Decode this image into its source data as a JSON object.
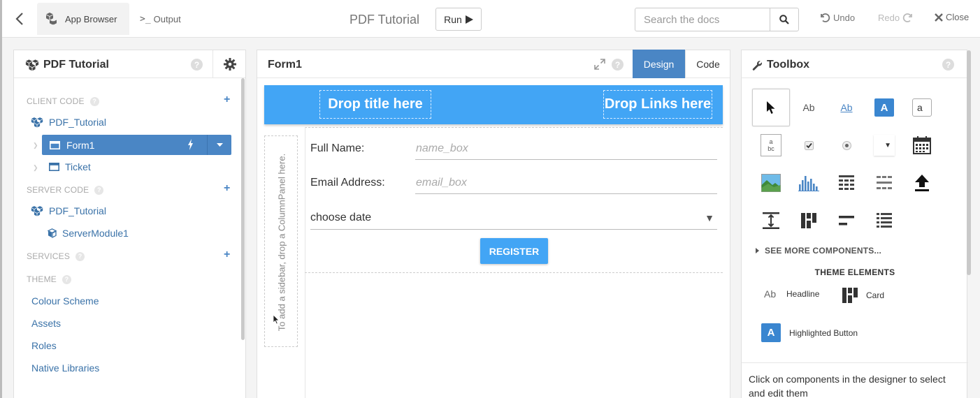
{
  "topbar": {
    "app_tab_label": "App Browser",
    "output_tab_label": "Output",
    "title": "PDF Tutorial",
    "run_label": "Run",
    "search_placeholder": "Search the docs",
    "undo_label": "Undo",
    "redo_label": "Redo",
    "close_label": "Close"
  },
  "left_panel": {
    "title": "PDF Tutorial",
    "client_code_label": "CLIENT CODE",
    "client_app": "PDF_Tutorial",
    "forms": [
      {
        "label": "Form1",
        "selected": true
      },
      {
        "label": "Ticket",
        "selected": false
      }
    ],
    "server_code_label": "SERVER CODE",
    "server_app": "PDF_Tutorial",
    "server_module": "ServerModule1",
    "services_label": "SERVICES",
    "theme_label": "THEME",
    "theme_items": [
      "Colour Scheme",
      "Assets",
      "Roles",
      "Native Libraries"
    ]
  },
  "designer": {
    "title": "Form1",
    "design_tab": "Design",
    "code_tab": "Code",
    "drop_title": "Drop title here",
    "drop_links": "Drop Links here",
    "sidebar_hint": "To add a sidebar, drop a ColumnPanel here.",
    "full_name_label": "Full Name:",
    "name_placeholder": "name_box",
    "email_label": "Email Address:",
    "email_placeholder": "email_box",
    "date_placeholder": "choose date",
    "register_label": "REGISTER",
    "accent_color": "#42a5f5"
  },
  "toolbox": {
    "title": "Toolbox",
    "label_sample": "Ab",
    "link_sample": "Ab",
    "button_sample": "A",
    "textbox_sample": "a",
    "textarea_sample": "a bc",
    "see_more": "SEE MORE COMPONENTS...",
    "theme_elements_title": "THEME ELEMENTS",
    "headline_sample": "Ab",
    "headline_label": "Headline",
    "card_label": "Card",
    "highlighted_sample": "A",
    "highlighted_label": "Highlighted Button",
    "hint": "Click on components in the designer to select and edit them"
  }
}
